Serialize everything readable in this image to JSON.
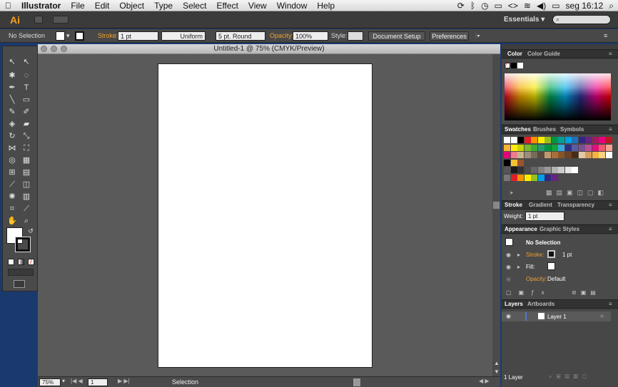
{
  "menubar": {
    "app": "Illustrator",
    "items": [
      "File",
      "Edit",
      "Object",
      "Type",
      "Select",
      "Effect",
      "View",
      "Window",
      "Help"
    ],
    "clock": "seg 16:12"
  },
  "appbar": {
    "logo": "Ai",
    "workspace": "Essentials",
    "workspace_arrow": "▾"
  },
  "controlbar": {
    "selection": "No Selection",
    "stroke_label": "Stroke:",
    "stroke_value": "1 pt",
    "profile": "Uniform",
    "brush": "5 pt. Round",
    "opacity_label": "Opacity:",
    "opacity_value": "100%",
    "style_label": "Style:",
    "document_setup": "Document Setup",
    "preferences": "Preferences"
  },
  "document": {
    "title": "Untitled-1 @ 75% (CMYK/Preview)"
  },
  "statusbar": {
    "zoom": "75%",
    "page": "1",
    "tool": "Selection"
  },
  "panels": {
    "color_tabs": [
      "Color",
      "Color Guide"
    ],
    "swatch_tabs": [
      "Swatches",
      "Brushes",
      "Symbols"
    ],
    "stroke_tabs": [
      "Stroke",
      "Gradient",
      "Transparency"
    ],
    "stroke_weight_label": "Weight:",
    "stroke_weight_value": "1 pt",
    "appearance_tabs": [
      "Appearance",
      "Graphic Styles"
    ],
    "appearance": {
      "title": "No Selection",
      "stroke_label": "Stroke:",
      "stroke_value": "1 pt",
      "fill_label": "Fill:",
      "opacity_label": "Opacity:",
      "opacity_value": "Default"
    },
    "layers_tabs": [
      "Layers",
      "Artboards"
    ],
    "layer_name": "Layer 1",
    "layers_count": "1 Layer"
  },
  "colors": {
    "accent": "#f0a030",
    "ui_dark": "#3e3e3e",
    "canvas": "#5a5a5a"
  }
}
